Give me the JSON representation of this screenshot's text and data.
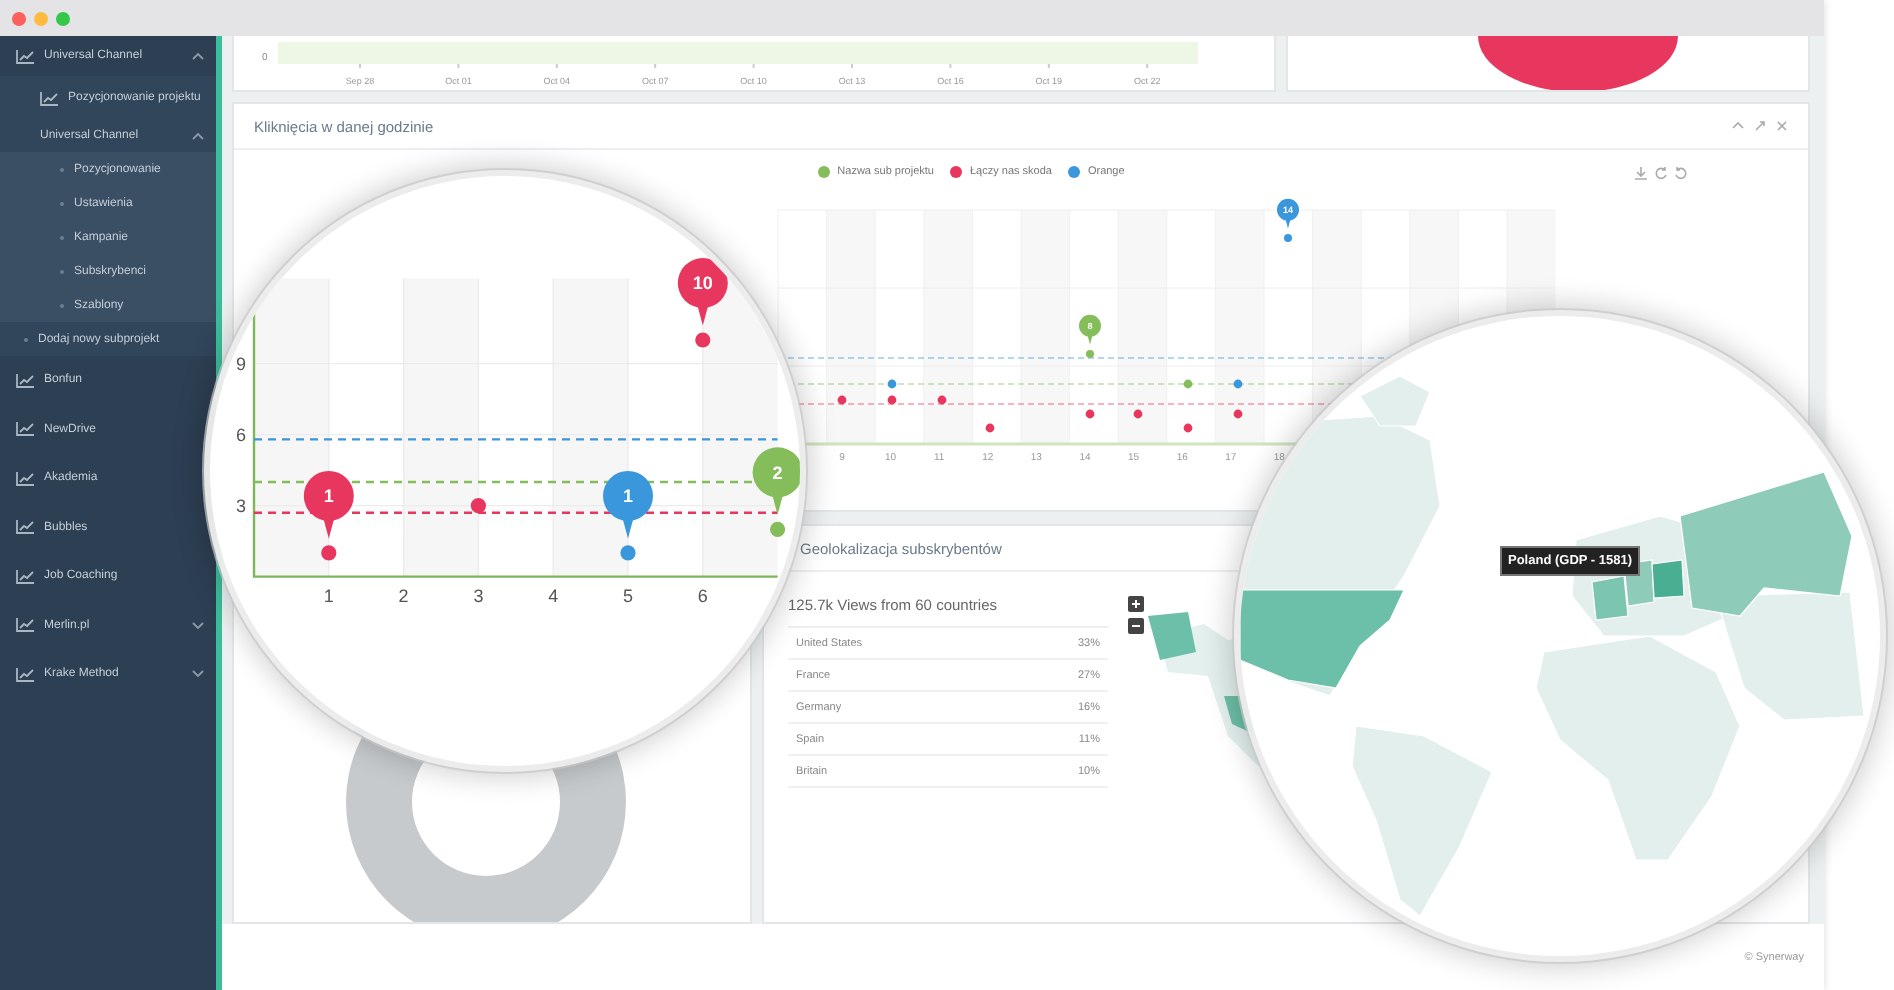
{
  "sidebar": {
    "items": [
      {
        "label": "Universal Channel",
        "kind": "project",
        "expanded": true,
        "children": [
          {
            "label": "Pozycjonowanie projektu",
            "kind": "project"
          },
          {
            "label": "Universal Channel",
            "kind": "group",
            "expanded": true,
            "children": [
              {
                "label": "Pozycjonowanie",
                "kind": "link"
              },
              {
                "label": "Ustawienia",
                "kind": "link"
              },
              {
                "label": "Kampanie",
                "kind": "link"
              },
              {
                "label": "Subskrybenci",
                "kind": "link"
              },
              {
                "label": "Szablony",
                "kind": "link"
              }
            ]
          },
          {
            "label": "Dodaj nowy subprojekt",
            "kind": "link"
          }
        ]
      },
      {
        "label": "Bonfun",
        "kind": "project"
      },
      {
        "label": "NewDrive",
        "kind": "project"
      },
      {
        "label": "Akademia",
        "kind": "project"
      },
      {
        "label": "Bubbles",
        "kind": "project"
      },
      {
        "label": "Job Coaching",
        "kind": "project"
      },
      {
        "label": "Merlin.pl",
        "kind": "project",
        "expanded": false
      },
      {
        "label": "Krake Method",
        "kind": "project",
        "expanded": false
      }
    ]
  },
  "top_chart": {
    "y_tick": "0",
    "x_labels": [
      "Sep 28",
      "Oct 01",
      "Oct 04",
      "Oct 07",
      "Oct 10",
      "Oct 13",
      "Oct 16",
      "Oct 19",
      "Oct 22"
    ]
  },
  "clicks_panel": {
    "title": "Kliknięcia w danej godzinie",
    "legend": [
      {
        "label": "Nazwa sub projektu",
        "color": "#86bd5b"
      },
      {
        "label": "Łączy nas skoda",
        "color": "#e8375e"
      },
      {
        "label": "Orange",
        "color": "#3a97dc"
      }
    ],
    "x_labels": [
      "9",
      "10",
      "11",
      "12",
      "13",
      "14",
      "15",
      "16",
      "17",
      "18"
    ],
    "pins": [
      {
        "color": "#86bd5b",
        "label": "8"
      },
      {
        "color": "#3a97dc",
        "label": "14"
      }
    ]
  },
  "magnifier_chart": {
    "chart_data": {
      "type": "scatter",
      "x": [
        1,
        2,
        3,
        4,
        5,
        6,
        7
      ],
      "xlim": [
        0,
        7
      ],
      "ylim": [
        0,
        12.6
      ],
      "xticks": [
        1,
        2,
        3,
        4,
        5,
        6
      ],
      "yticks": [
        3,
        6,
        9
      ],
      "grid": true,
      "series": [
        {
          "color": "#86bd5b",
          "values": [
            null,
            null,
            null,
            null,
            null,
            null,
            2
          ]
        },
        {
          "color": "#e8375e",
          "values": [
            1,
            null,
            3,
            null,
            null,
            10,
            null
          ]
        },
        {
          "color": "#3a97dc",
          "values": [
            null,
            null,
            null,
            null,
            1,
            null,
            null
          ]
        }
      ],
      "ref_lines": [
        {
          "axis": "y",
          "value": 5.8,
          "color": "#3a97dc"
        },
        {
          "axis": "y",
          "value": 4,
          "color": "#86bd5b"
        },
        {
          "axis": "y",
          "value": 2.7,
          "color": "#e8375e"
        }
      ],
      "annotations": [
        {
          "x": 1,
          "y": 1,
          "text": "1"
        },
        {
          "x": 6,
          "y": 10,
          "text": "10"
        },
        {
          "x": 5,
          "y": 1,
          "text": "1"
        },
        {
          "x": 7,
          "y": 2,
          "text": "2"
        }
      ]
    }
  },
  "geo_panel": {
    "title": "Geolokalizacja subskrybentów",
    "summary": "125.7k Views from 60 countries",
    "rows": [
      {
        "country": "United States",
        "share": "33%"
      },
      {
        "country": "France",
        "share": "27%"
      },
      {
        "country": "Germany",
        "share": "16%"
      },
      {
        "country": "Spain",
        "share": "11%"
      },
      {
        "country": "Britain",
        "share": "10%"
      }
    ],
    "map_tooltip": "Poland (GDP - 1581)"
  },
  "footer": "© Synerway"
}
